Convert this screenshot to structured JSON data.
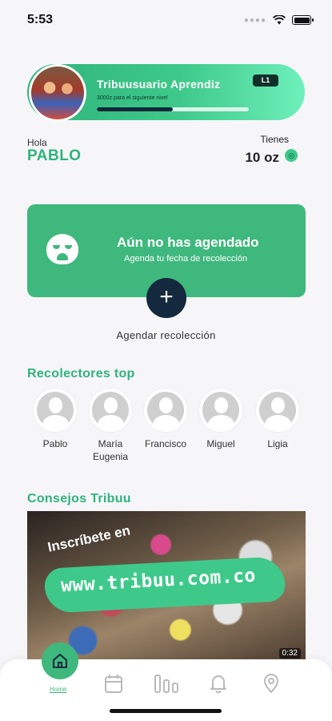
{
  "status_bar": {
    "time": "5:53"
  },
  "profile": {
    "level_title": "Tribuusuario Aprendiz",
    "level_progress_text": "3000z para el siguiente nivel",
    "level_badge": "L1",
    "level_progress": 0.5,
    "greeting": "Hola",
    "name": "PABLO",
    "balance_label": "Tienes",
    "balance_value": "10 oz"
  },
  "schedule": {
    "title": "Aún no has agendado",
    "subtitle": "Agenda tu fecha de recolección",
    "add_label": "Agendar recolección"
  },
  "collectors": {
    "title": "Recolectores top",
    "items": [
      {
        "name": "Pablo"
      },
      {
        "name": "María Eugenia"
      },
      {
        "name": "Francisco"
      },
      {
        "name": "Miguel"
      },
      {
        "name": "Ligia"
      }
    ]
  },
  "tips": {
    "title": "Consejos Tribuu",
    "video_pre": "Inscríbete en",
    "video_url": "www.tribuu.com.co",
    "video_duration": "0:32"
  },
  "nav": {
    "home_label": "Home",
    "items": [
      "home-icon",
      "calendar-icon",
      "stats-icon",
      "bell-icon",
      "location-icon"
    ]
  },
  "colors": {
    "accent": "#3fb87d",
    "dark": "#14283e"
  }
}
